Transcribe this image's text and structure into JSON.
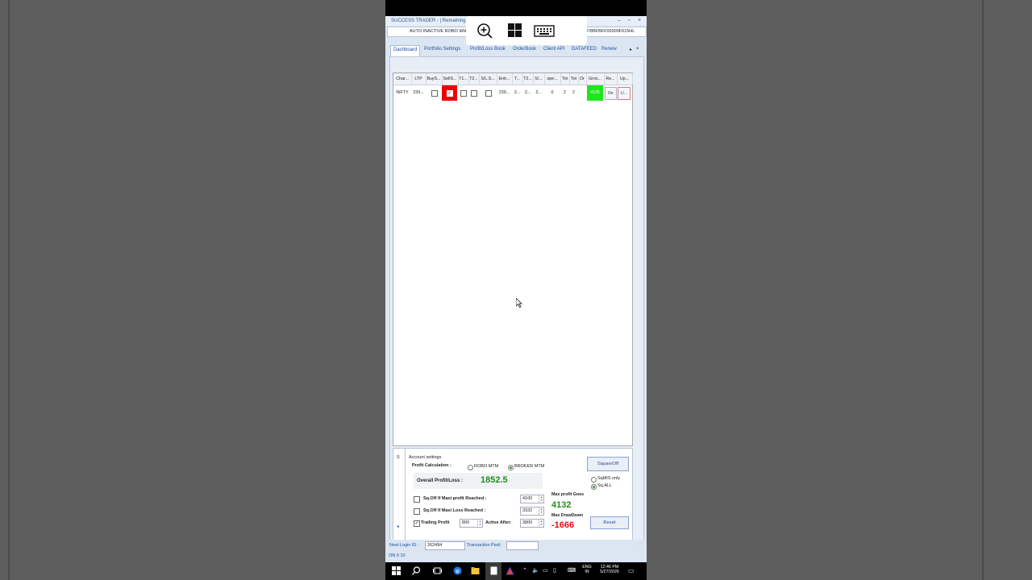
{
  "window": {
    "title": "SUCCESS TRADER - | Remaining Day",
    "address_left": "AUTO INACTIVE ROBO WH",
    "address_right": "C6118FB4078BFBFF00000F615HL"
  },
  "tabs": [
    {
      "label": "Dashboard",
      "active": true
    },
    {
      "label": "Portfolio Settings"
    },
    {
      "label": "Profit/Loss Book"
    },
    {
      "label": "OrderBook"
    },
    {
      "label": "Client API"
    },
    {
      "label": "DATAFEED"
    },
    {
      "label": "Renew"
    }
  ],
  "grid": {
    "headers": [
      "Char...",
      "LTP",
      "BuyS...",
      "SellS...",
      "T1...",
      "T2...",
      "S/L.S...",
      "Entr...",
      "T...",
      "T2...",
      "S/...",
      "ope...",
      "Tot",
      "Tot",
      "Or",
      "Gros...",
      "Re...",
      "Up..."
    ],
    "row": {
      "symbol": "NIFTY",
      "ltp": "239...",
      "entry": "239...",
      "t": "2...",
      "t2": "2...",
      "sl": "2...",
      "open": "0",
      "tot1": "2",
      "tot2": "2",
      "gross": "4125",
      "reset": "Re",
      "update": "U..."
    }
  },
  "account": {
    "section_label": "Account settings",
    "left_marker": "S",
    "profit_calc_label": "Profit Calculation :",
    "robo_mtm": "ROBO MTM",
    "broker_mtm": "BROKER MTM",
    "overall_label": "Overall Profit/Loss :",
    "overall_value": "1852.5",
    "sqoff_max_profit_label": "Sq.Off If Maxi profit Reached :",
    "sqoff_max_profit_value": "4100",
    "sqoff_max_loss_label": "Sq.Off If Maxi Loss Reached :",
    "sqoff_max_loss_value": "3332",
    "trailing_label": "Trailing Profit",
    "trailing_value": "800",
    "active_after_label": "Active After:",
    "active_after_value": "3800",
    "squareoff_button": "SquareOff",
    "sqmis_label": "SqMIS only",
    "sqall_label": "Sq.ALL",
    "max_profit_label": "Max profit Goes",
    "max_profit_value": "4132",
    "max_drawdown_label": "Max DrawDown",
    "max_drawdown_value": "-1666",
    "reset_button": "Reset"
  },
  "status": {
    "nest_login_label": "Nest Login ID :",
    "nest_login_value": "262494",
    "transaction_label": "Transaction Pwd:",
    "bottom_text": "ON 9 10"
  },
  "taskbar": {
    "lang_top": "ENG",
    "lang_bottom": "IN",
    "time": "12:46 PM",
    "date": "5/27/2026"
  },
  "colors": {
    "profit_green": "#1f8f1f",
    "loss_red": "#e01010",
    "gross_green": "#1ee61e"
  }
}
